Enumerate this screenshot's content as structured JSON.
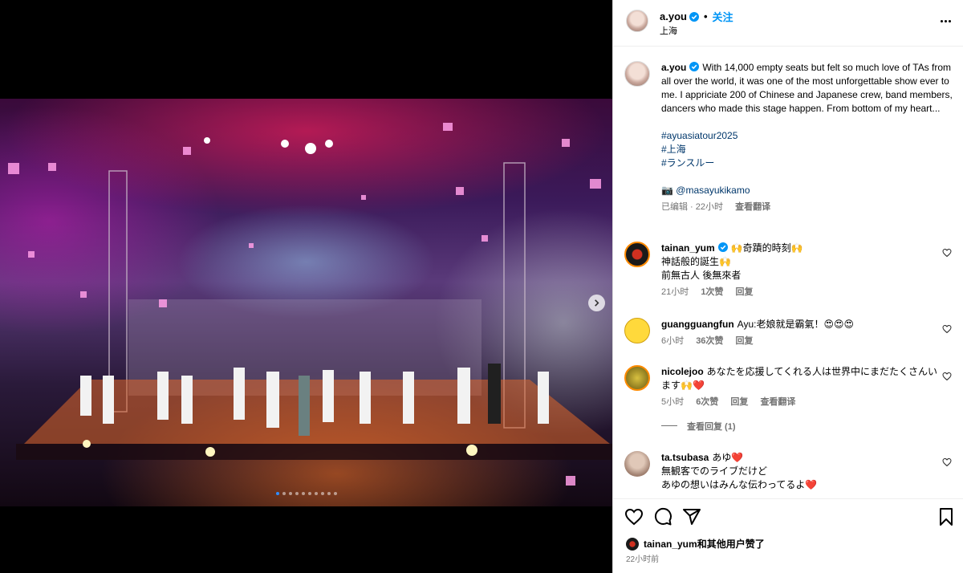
{
  "post": {
    "author": "a.you",
    "follow_label": "关注",
    "location": "上海",
    "caption_text": "With 14,000 empty seats but felt so much love of TAs from all over the world, it was one of the most unforgettable show ever to me. I appriciate 200 of Chinese and Japanese crew, band members, dancers who made this stage happen. From bottom of my heart...",
    "hashtags": [
      "#ayuasiatour2025",
      "#上海",
      "#ランスルー"
    ],
    "photo_credit_icon": "📷",
    "photo_credit_mention": "@masayukikamo",
    "edited_label": "已编辑 · 22小时",
    "translate_label": "查看翻译",
    "carousel_count": 10,
    "carousel_active_index": 0
  },
  "comments": [
    {
      "user": "tainan_yum",
      "verified": true,
      "lines": [
        "🙌奇蹟的時刻🙌",
        "神話般的誕生🙌",
        "前無古人 後無來者"
      ],
      "time": "21小时",
      "likes": "1次赞",
      "reply": "回复",
      "avatar_color": "#1a1a1a"
    },
    {
      "user": "guangguangfun",
      "verified": false,
      "lines": [
        "Ayu:老娘就是霸氣！😍😍😍"
      ],
      "time": "6小时",
      "likes": "36次赞",
      "reply": "回复",
      "avatar_color": "#ffd93b"
    },
    {
      "user": "nicolejoo",
      "verified": false,
      "lines": [
        "あなたを応援してくれる人は世界中にまだたくさんいます🙌❤️"
      ],
      "time": "5小时",
      "likes": "6次赞",
      "reply": "回复",
      "translate": "查看翻译",
      "view_replies": "查看回复 (1)",
      "avatar_color": "#b8a030"
    },
    {
      "user": "ta.tsubasa",
      "verified": false,
      "lines": [
        "あゆ❤️",
        "無観客でのライブだけど",
        "あゆの想いはみんな伝わってるよ❤️"
      ],
      "avatar_color": "#a08070"
    }
  ],
  "footer": {
    "liked_by_user": "tainan_yum",
    "liked_by_suffix": "和其他用户赞了",
    "post_time": "22小时前"
  },
  "colors": {
    "accent": "#0095f6",
    "verified": "#0095f6",
    "heart": "#ff3040",
    "muted": "#737373"
  }
}
